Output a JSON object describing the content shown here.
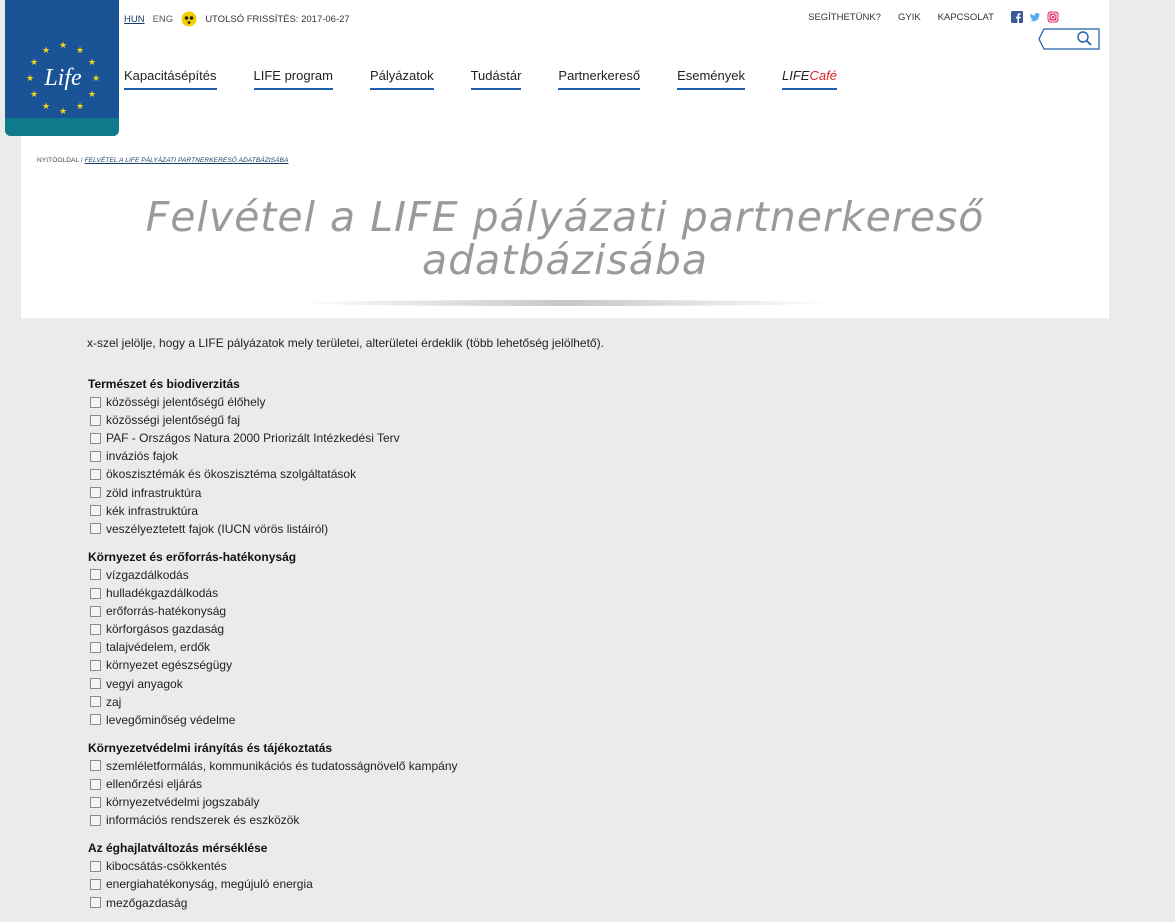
{
  "lang": {
    "hun": "HUN",
    "eng": "ENG",
    "update": "UTOLSÓ FRISSÍTÉS: 2017-06-27"
  },
  "top_links": [
    "SEGÍTHETÜNK?",
    "GYIK",
    "KAPCSOLAT"
  ],
  "logo_text": "Life",
  "nav": [
    "Kapacitásépítés",
    "LIFE program",
    "Pályázatok",
    "Tudástár",
    "Partnerkereső",
    "Események"
  ],
  "nav_cafe": {
    "a": "LIFE",
    "b": "Café"
  },
  "breadcrumb": {
    "home": "NYITÓOLDAL",
    "sep": " / ",
    "current": "FELVÉTEL A LIFE PÁLYÁZATI PARTNERKERESŐ ADATBÁZISÁBA"
  },
  "title": {
    "line1": "Felvétel a LIFE pályázati partnerkereső",
    "line2": "adatbázisába"
  },
  "intro": "x-szel jelölje, hogy a LIFE pályázatok mely területei, alterületei érdeklik (több lehetőség jelölhető).",
  "sections": [
    {
      "title": "Természet és biodiverzitás",
      "items": [
        "közösségi jelentőségű élőhely",
        "közösségi jelentőségű faj",
        "PAF - Országos Natura 2000 Priorizált Intézkedési Terv",
        "inváziós fajok",
        "ökoszisztémák és ökoszisztéma szolgáltatások",
        "zöld infrastruktúra",
        "kék infrastruktúra",
        "veszélyeztetett fajok (IUCN vörös listáiról)"
      ]
    },
    {
      "title": "Környezet és erőforrás-hatékonyság",
      "items": [
        "vízgazdálkodás",
        "hulladékgazdálkodás",
        "erőforrás-hatékonyság",
        "körforgásos gazdaság",
        "talajvédelem, erdők",
        "környezet egészségügy",
        "vegyi anyagok",
        "zaj",
        "levegőminőség védelme"
      ]
    },
    {
      "title": "Környezetvédelmi irányítás és tájékoztatás",
      "items": [
        "szemléletformálás, kommunikációs és tudatosságnövelő kampány",
        "ellenőrzési eljárás",
        "környezetvédelmi jogszabály",
        "információs rendszerek és eszközök"
      ]
    },
    {
      "title": "Az éghajlatváltozás mérséklése",
      "items": [
        "kibocsátás-csökkentés",
        "energiahatékonyság, megújuló energia",
        "mezőgazdaság"
      ]
    }
  ]
}
